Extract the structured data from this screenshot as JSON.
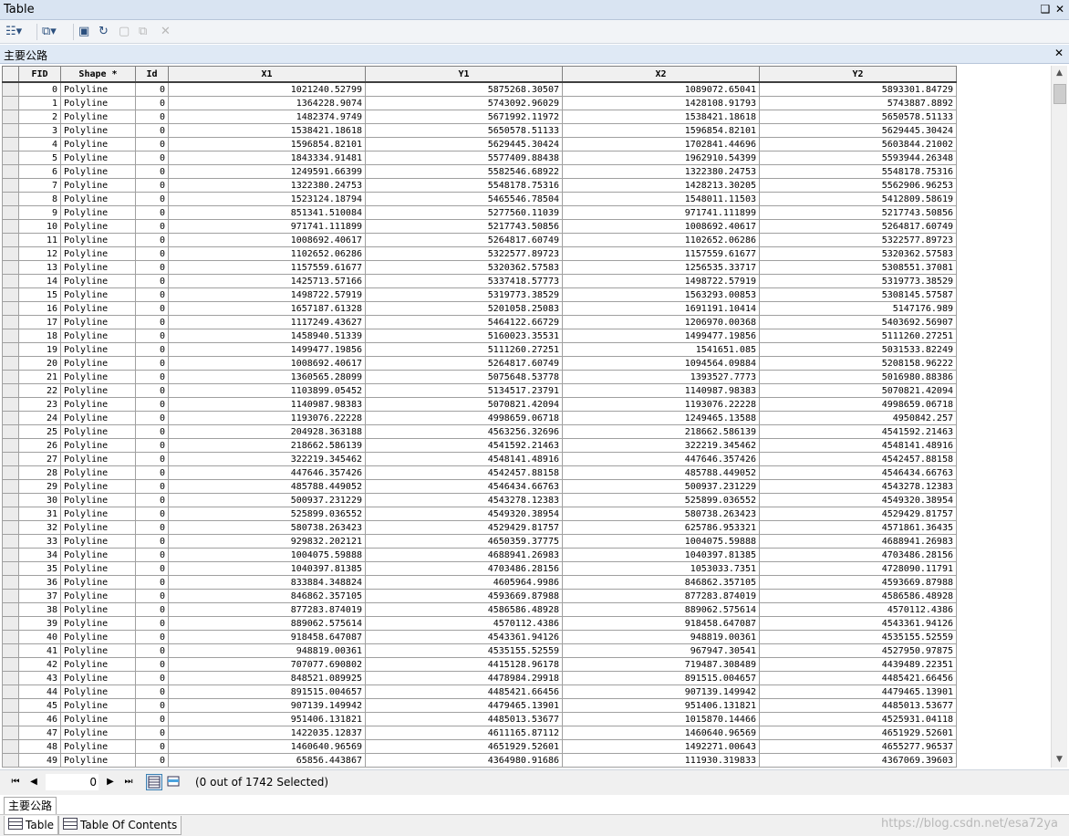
{
  "window": {
    "title": "Table",
    "pin_glyph": "❑",
    "close_glyph": "✕"
  },
  "toolbar": {
    "items": [
      {
        "name": "table-options-icon",
        "glyph": "☷▾"
      },
      {
        "name": "related-tables-icon",
        "glyph": "⧉▾"
      },
      {
        "name": "select-by-attributes-icon",
        "glyph": "▣"
      },
      {
        "name": "switch-selection-icon",
        "glyph": "↻"
      },
      {
        "name": "clear-selection-icon",
        "glyph": "▢"
      },
      {
        "name": "zoom-to-selected-icon",
        "glyph": "⧉"
      },
      {
        "name": "delete-selected-icon",
        "glyph": "✕"
      }
    ]
  },
  "layer": {
    "name": "主要公路",
    "close_glyph": "✕"
  },
  "columns": [
    "FID",
    "Shape *",
    "Id",
    "X1",
    "Y1",
    "X2",
    "Y2"
  ],
  "rows": [
    [
      "0",
      "Polyline",
      "0",
      "1021240.52799",
      "5875268.30507",
      "1089072.65041",
      "5893301.84729"
    ],
    [
      "1",
      "Polyline",
      "0",
      "1364228.9074",
      "5743092.96029",
      "1428108.91793",
      "5743887.8892"
    ],
    [
      "2",
      "Polyline",
      "0",
      "1482374.9749",
      "5671992.11972",
      "1538421.18618",
      "5650578.51133"
    ],
    [
      "3",
      "Polyline",
      "0",
      "1538421.18618",
      "5650578.51133",
      "1596854.82101",
      "5629445.30424"
    ],
    [
      "4",
      "Polyline",
      "0",
      "1596854.82101",
      "5629445.30424",
      "1702841.44696",
      "5603844.21002"
    ],
    [
      "5",
      "Polyline",
      "0",
      "1843334.91481",
      "5577409.88438",
      "1962910.54399",
      "5593944.26348"
    ],
    [
      "6",
      "Polyline",
      "0",
      "1249591.66399",
      "5582546.68922",
      "1322380.24753",
      "5548178.75316"
    ],
    [
      "7",
      "Polyline",
      "0",
      "1322380.24753",
      "5548178.75316",
      "1428213.30205",
      "5562906.96253"
    ],
    [
      "8",
      "Polyline",
      "0",
      "1523124.18794",
      "5465546.78504",
      "1548011.11503",
      "5412809.58619"
    ],
    [
      "9",
      "Polyline",
      "0",
      "851341.510084",
      "5277560.11039",
      "971741.111899",
      "5217743.50856"
    ],
    [
      "10",
      "Polyline",
      "0",
      "971741.111899",
      "5217743.50856",
      "1008692.40617",
      "5264817.60749"
    ],
    [
      "11",
      "Polyline",
      "0",
      "1008692.40617",
      "5264817.60749",
      "1102652.06286",
      "5322577.89723"
    ],
    [
      "12",
      "Polyline",
      "0",
      "1102652.06286",
      "5322577.89723",
      "1157559.61677",
      "5320362.57583"
    ],
    [
      "13",
      "Polyline",
      "0",
      "1157559.61677",
      "5320362.57583",
      "1256535.33717",
      "5308551.37081"
    ],
    [
      "14",
      "Polyline",
      "0",
      "1425713.57166",
      "5337418.57773",
      "1498722.57919",
      "5319773.38529"
    ],
    [
      "15",
      "Polyline",
      "0",
      "1498722.57919",
      "5319773.38529",
      "1563293.00853",
      "5308145.57587"
    ],
    [
      "16",
      "Polyline",
      "0",
      "1657187.61328",
      "5201058.25083",
      "1691191.10414",
      "5147176.989"
    ],
    [
      "17",
      "Polyline",
      "0",
      "1117249.43627",
      "5464122.66729",
      "1206970.00368",
      "5403692.56907"
    ],
    [
      "18",
      "Polyline",
      "0",
      "1458940.51339",
      "5160023.35531",
      "1499477.19856",
      "5111260.27251"
    ],
    [
      "19",
      "Polyline",
      "0",
      "1499477.19856",
      "5111260.27251",
      "1541651.085",
      "5031533.82249"
    ],
    [
      "20",
      "Polyline",
      "0",
      "1008692.40617",
      "5264817.60749",
      "1094564.09884",
      "5208158.96222"
    ],
    [
      "21",
      "Polyline",
      "0",
      "1360565.28099",
      "5075648.53778",
      "1393527.7773",
      "5016980.88386"
    ],
    [
      "22",
      "Polyline",
      "0",
      "1103899.05452",
      "5134517.23791",
      "1140987.98383",
      "5070821.42094"
    ],
    [
      "23",
      "Polyline",
      "0",
      "1140987.98383",
      "5070821.42094",
      "1193076.22228",
      "4998659.06718"
    ],
    [
      "24",
      "Polyline",
      "0",
      "1193076.22228",
      "4998659.06718",
      "1249465.13588",
      "4950842.257"
    ],
    [
      "25",
      "Polyline",
      "0",
      "204928.363188",
      "4563256.32696",
      "218662.586139",
      "4541592.21463"
    ],
    [
      "26",
      "Polyline",
      "0",
      "218662.586139",
      "4541592.21463",
      "322219.345462",
      "4548141.48916"
    ],
    [
      "27",
      "Polyline",
      "0",
      "322219.345462",
      "4548141.48916",
      "447646.357426",
      "4542457.88158"
    ],
    [
      "28",
      "Polyline",
      "0",
      "447646.357426",
      "4542457.88158",
      "485788.449052",
      "4546434.66763"
    ],
    [
      "29",
      "Polyline",
      "0",
      "485788.449052",
      "4546434.66763",
      "500937.231229",
      "4543278.12383"
    ],
    [
      "30",
      "Polyline",
      "0",
      "500937.231229",
      "4543278.12383",
      "525899.036552",
      "4549320.38954"
    ],
    [
      "31",
      "Polyline",
      "0",
      "525899.036552",
      "4549320.38954",
      "580738.263423",
      "4529429.81757"
    ],
    [
      "32",
      "Polyline",
      "0",
      "580738.263423",
      "4529429.81757",
      "625786.953321",
      "4571861.36435"
    ],
    [
      "33",
      "Polyline",
      "0",
      "929832.202121",
      "4650359.37775",
      "1004075.59888",
      "4688941.26983"
    ],
    [
      "34",
      "Polyline",
      "0",
      "1004075.59888",
      "4688941.26983",
      "1040397.81385",
      "4703486.28156"
    ],
    [
      "35",
      "Polyline",
      "0",
      "1040397.81385",
      "4703486.28156",
      "1053033.7351",
      "4728090.11791"
    ],
    [
      "36",
      "Polyline",
      "0",
      "833884.348824",
      "4605964.9986",
      "846862.357105",
      "4593669.87988"
    ],
    [
      "37",
      "Polyline",
      "0",
      "846862.357105",
      "4593669.87988",
      "877283.874019",
      "4586586.48928"
    ],
    [
      "38",
      "Polyline",
      "0",
      "877283.874019",
      "4586586.48928",
      "889062.575614",
      "4570112.4386"
    ],
    [
      "39",
      "Polyline",
      "0",
      "889062.575614",
      "4570112.4386",
      "918458.647087",
      "4543361.94126"
    ],
    [
      "40",
      "Polyline",
      "0",
      "918458.647087",
      "4543361.94126",
      "948819.00361",
      "4535155.52559"
    ],
    [
      "41",
      "Polyline",
      "0",
      "948819.00361",
      "4535155.52559",
      "967947.30541",
      "4527950.97875"
    ],
    [
      "42",
      "Polyline",
      "0",
      "707077.690802",
      "4415128.96178",
      "719487.308489",
      "4439489.22351"
    ],
    [
      "43",
      "Polyline",
      "0",
      "848521.089925",
      "4478984.29918",
      "891515.004657",
      "4485421.66456"
    ],
    [
      "44",
      "Polyline",
      "0",
      "891515.004657",
      "4485421.66456",
      "907139.149942",
      "4479465.13901"
    ],
    [
      "45",
      "Polyline",
      "0",
      "907139.149942",
      "4479465.13901",
      "951406.131821",
      "4485013.53677"
    ],
    [
      "46",
      "Polyline",
      "0",
      "951406.131821",
      "4485013.53677",
      "1015870.14466",
      "4525931.04118"
    ],
    [
      "47",
      "Polyline",
      "0",
      "1422035.12837",
      "4611165.87112",
      "1460640.96569",
      "4651929.52601"
    ],
    [
      "48",
      "Polyline",
      "0",
      "1460640.96569",
      "4651929.52601",
      "1492271.00643",
      "4655277.96537"
    ],
    [
      "49",
      "Polyline",
      "0",
      "65856.443867",
      "4364980.91686",
      "111930.319833",
      "4367069.39603"
    ]
  ],
  "navigation": {
    "first_glyph": "⏮",
    "prev_glyph": "◀",
    "next_glyph": "▶",
    "last_glyph": "⏭",
    "current_record": "0",
    "selection_info": "(0 out of 1742 Selected)"
  },
  "layer_tab": "主要公路",
  "bottom_tabs": [
    {
      "label": "Table"
    },
    {
      "label": "Table Of Contents"
    }
  ],
  "watermark": "https://blog.csdn.net/esa72ya",
  "colors": {
    "header_bar": "#d9e4f2",
    "layer_bar": "#dfe9f5",
    "accent": "#3c7fb1"
  }
}
